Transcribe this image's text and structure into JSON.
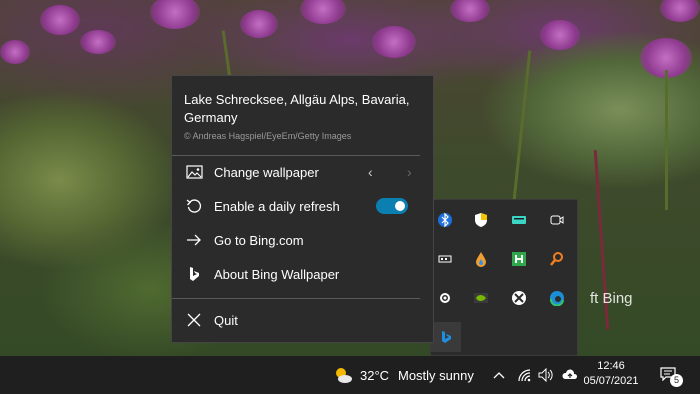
{
  "wallpaper": {
    "location": "Lake Schrecksee, Allgäu Alps, Bavaria, Germany",
    "credit": "© Andreas Hagspiel/EyeEm/Getty Images"
  },
  "menu": {
    "items": [
      {
        "label": "Change wallpaper",
        "icon": "picture-icon"
      },
      {
        "label": "Enable a daily refresh",
        "icon": "refresh-icon"
      },
      {
        "label": "Go to Bing.com",
        "icon": "arrow-right-icon"
      },
      {
        "label": "About Bing Wallpaper",
        "icon": "bing-logo-icon"
      }
    ],
    "quit_label": "Quit",
    "daily_refresh_enabled": true,
    "toggle_color": "#0b7fb0"
  },
  "tray_flyout": {
    "icons": [
      "bluetooth-icon",
      "windows-defender-icon",
      "keyboard-icon",
      "camera-icon",
      "usb-device-icon",
      "water-drop-icon",
      "h-app-icon",
      "search-app-icon",
      "settings-gear-icon",
      "nvidia-icon",
      "xbox-icon",
      "edge-icon",
      "bing-icon"
    ],
    "behind_text": "ft Bing"
  },
  "taskbar": {
    "temperature": "32°C",
    "condition": "Mostly sunny",
    "time": "12:46",
    "date": "05/07/2021",
    "notification_count": "5"
  }
}
